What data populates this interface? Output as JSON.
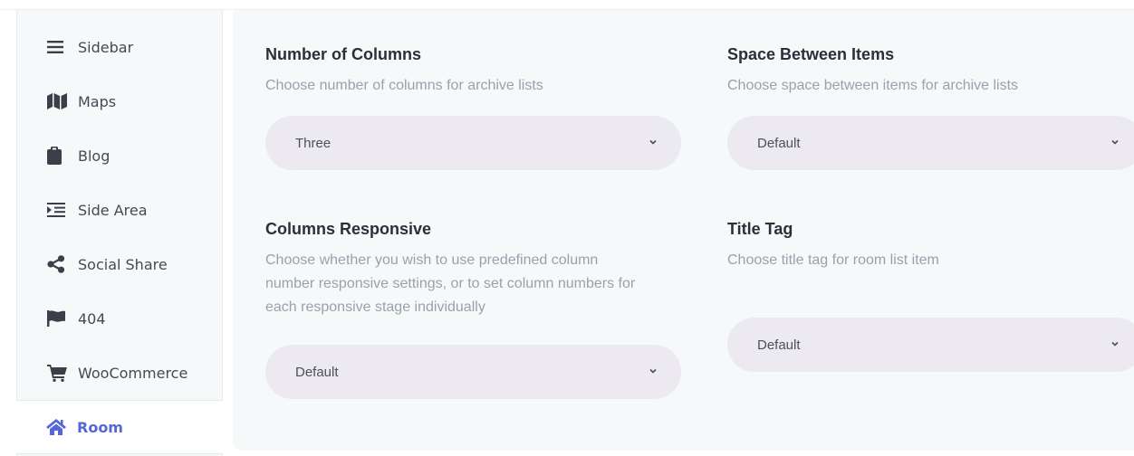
{
  "sidebar": {
    "items": [
      {
        "label": "Sidebar",
        "icon": "hamburger-icon"
      },
      {
        "label": "Maps",
        "icon": "map-icon"
      },
      {
        "label": "Blog",
        "icon": "clipboard-icon"
      },
      {
        "label": "Side Area",
        "icon": "indent-icon"
      },
      {
        "label": "Social Share",
        "icon": "share-icon"
      },
      {
        "label": "404",
        "icon": "flag-icon"
      },
      {
        "label": "WooCommerce",
        "icon": "cart-icon"
      },
      {
        "label": "Room",
        "icon": "home-icon",
        "active": true
      }
    ],
    "active_color": "#5566d9"
  },
  "settings": {
    "number_of_columns": {
      "title": "Number of Columns",
      "description": "Choose number of columns for archive lists",
      "value": "Three"
    },
    "space_between_items": {
      "title": "Space Between Items",
      "description": "Choose space between items for archive lists",
      "value": "Default"
    },
    "columns_responsive": {
      "title": "Columns Responsive",
      "description_lines": [
        "Choose whether you wish to use predefined column",
        "number responsive settings, or to set column numbers for",
        "each responsive stage individually"
      ],
      "value": "Default"
    },
    "title_tag": {
      "title": "Title Tag",
      "description": "Choose title tag for room list item",
      "value": "Default"
    }
  }
}
